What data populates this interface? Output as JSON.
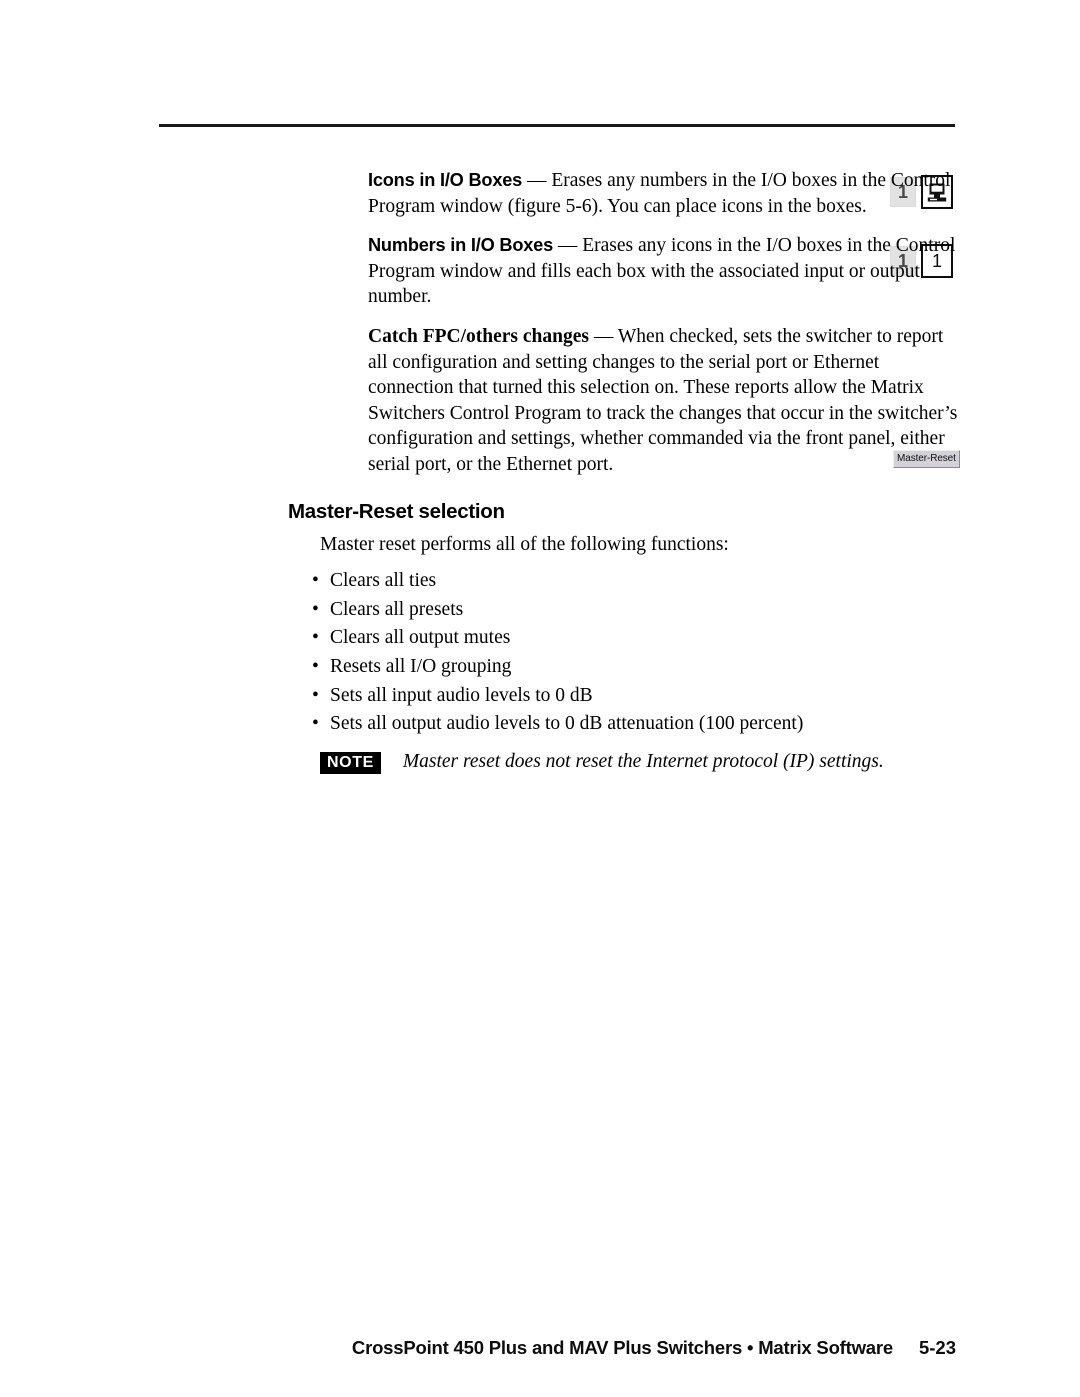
{
  "document": {
    "divider": "horizontal-rule"
  },
  "definitions": [
    {
      "term": "Icons in I/O Boxes",
      "dash": " — ",
      "body": "Erases any numbers in the I/O boxes in the Control Program window (figure 5-6).  You can place icons in the boxes.",
      "term_style": "sans-bold"
    },
    {
      "term": "Numbers in I/O Boxes",
      "dash": " — ",
      "body": "Erases any icons in the I/O boxes in the Control Program window and fills each box with the associated input or output number.",
      "term_style": "sans-bold"
    },
    {
      "term": "Catch FPC/others changes",
      "dash": " — ",
      "body": "When checked, sets the switcher to report all configuration and setting changes to the serial port or Ethernet connection that turned this selection on.  These reports allow the Matrix Switchers Control Program to track the changes that occur in the switcher’s configuration and settings, whether commanded via the front panel, either serial port, or the Ethernet port.",
      "term_style": "serif-bold"
    }
  ],
  "section": {
    "heading": "Master-Reset selection",
    "lead": "Master reset performs all of the following functions:",
    "bullet_char": "•",
    "bullets": [
      "Clears all ties",
      "Clears all presets",
      "Clears all output mutes",
      "Resets all I/O grouping",
      "Sets all input audio levels to 0 dB",
      "Sets all output audio levels to 0 dB attenuation (100 percent)"
    ]
  },
  "note": {
    "badge": "NOTE",
    "text": "Master reset does not reset the Internet protocol (IP) settings."
  },
  "glyphs": {
    "icons_row": {
      "dim_box_label": "1",
      "icon_name": "computer-monitor-icon"
    },
    "numbers_row": {
      "dim_box_label": "1",
      "plain_box_label": "1"
    },
    "master_reset_button": "Master-Reset"
  },
  "footer": {
    "title": "CrossPoint 450 Plus and MAV Plus Switchers • Matrix Software",
    "page": "5-23"
  },
  "colors": {
    "text": "#000000",
    "rule": "#1a1a1a",
    "note_badge_bg": "#000000",
    "button_face": "#d4d2d8",
    "dim_box": "#e2e2e2"
  }
}
